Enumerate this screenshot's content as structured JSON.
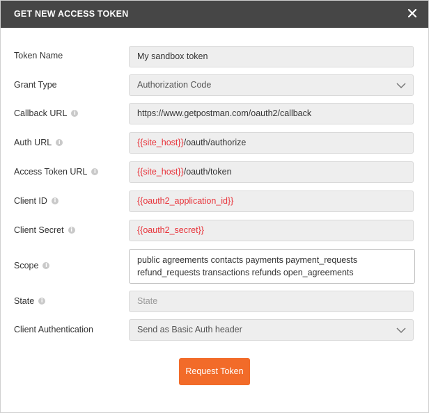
{
  "dialog": {
    "title": "GET NEW ACCESS TOKEN",
    "icons": {
      "close": "close-icon",
      "info": "info-icon",
      "dropdown": "chevron-down-icon"
    }
  },
  "form": {
    "token_name": {
      "label": "Token Name",
      "value": "My sandbox token"
    },
    "grant_type": {
      "label": "Grant Type",
      "value": "Authorization Code"
    },
    "callback_url": {
      "label": "Callback URL",
      "value": "https://www.getpostman.com/oauth2/callback"
    },
    "auth_url": {
      "label": "Auth URL",
      "var": "{{site_host}}",
      "rest": "/oauth/authorize"
    },
    "access_token_url": {
      "label": "Access Token URL",
      "var": "{{site_host}}",
      "rest": "/oauth/token"
    },
    "client_id": {
      "label": "Client ID",
      "value": "{{oauth2_application_id}}"
    },
    "client_secret": {
      "label": "Client Secret",
      "value": "{{oauth2_secret}}"
    },
    "scope": {
      "label": "Scope",
      "line1": "public agreements contacts payments payment_requests",
      "line2": "refund_requests transactions refunds open_agreements"
    },
    "state": {
      "label": "State",
      "placeholder": "State"
    },
    "client_authentication": {
      "label": "Client Authentication",
      "value": "Send as Basic Auth header"
    }
  },
  "actions": {
    "request_token": "Request Token"
  },
  "colors": {
    "accent": "#f26b29",
    "variable": "#e8333a",
    "titlebar": "#464646"
  }
}
